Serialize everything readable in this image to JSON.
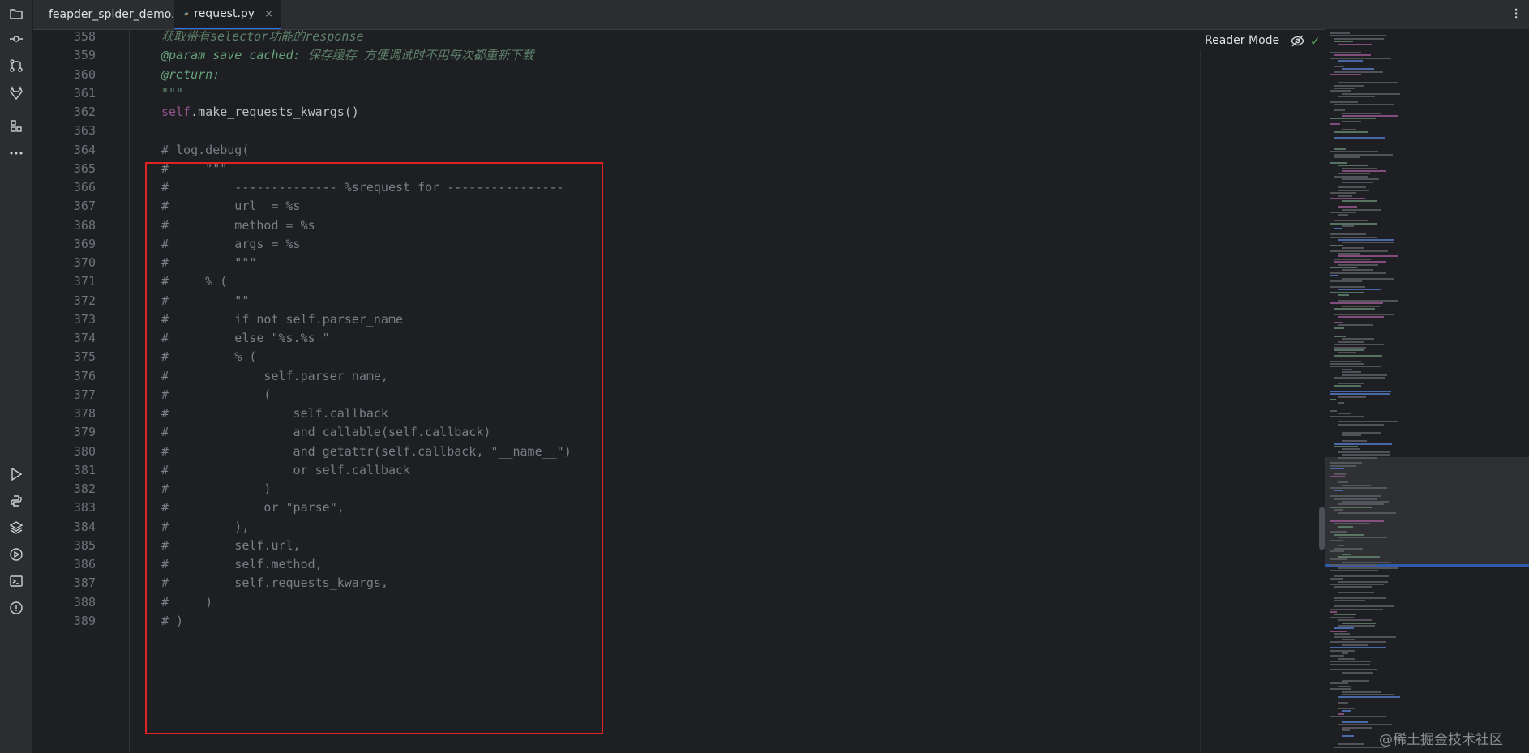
{
  "tabs": [
    {
      "label": "feapder_spider_demo.py",
      "active": false
    },
    {
      "label": "request.py",
      "active": true,
      "close": "×"
    }
  ],
  "reader_mode": "Reader Mode",
  "watermark": "@稀土掘金技术社区",
  "icons": {
    "toolstrip": [
      "project-icon",
      "commit-icon",
      "pull-requests-icon",
      "gitlab-icon",
      "structure-icon",
      "more-tools-icon",
      "run-icon",
      "python-console-icon",
      "layers-icon",
      "services-icon",
      "terminal-icon",
      "problems-icon"
    ],
    "reader": [
      "eye-slash-icon",
      "check-icon"
    ]
  },
  "colors": {
    "background": "#1e1f22",
    "highlight_box": "#e02424",
    "docstring": "#5f826b",
    "comment": "#7a7e85",
    "self": "#94558d",
    "accent": "#3574f0"
  },
  "lines": [
    {
      "n": "358",
      "parts": [
        {
          "t": "获取带有selector功能的response",
          "c": "doc"
        }
      ]
    },
    {
      "n": "359",
      "parts": [
        {
          "t": "@param save_cached:",
          "c": "doctag"
        },
        {
          "t": " 保存缓存 方便调试时不用每次都重新下载",
          "c": "doc"
        }
      ]
    },
    {
      "n": "360",
      "parts": [
        {
          "t": "@return:",
          "c": "doctag"
        }
      ]
    },
    {
      "n": "361",
      "parts": [
        {
          "t": "\"\"\"",
          "c": "doc"
        }
      ]
    },
    {
      "n": "362",
      "parts": [
        {
          "t": "self",
          "c": "kwself"
        },
        {
          "t": ".make_requests_kwargs()",
          "c": "plain"
        }
      ]
    },
    {
      "n": "363",
      "parts": []
    },
    {
      "n": "364",
      "parts": [
        {
          "t": "# log.debug(",
          "c": "cmt"
        }
      ]
    },
    {
      "n": "365",
      "parts": [
        {
          "t": "#     \"\"\"",
          "c": "cmt"
        }
      ]
    },
    {
      "n": "366",
      "parts": [
        {
          "t": "#         -------------- %srequest for ----------------",
          "c": "cmt"
        }
      ]
    },
    {
      "n": "367",
      "parts": [
        {
          "t": "#         url  = %s",
          "c": "cmt"
        }
      ]
    },
    {
      "n": "368",
      "parts": [
        {
          "t": "#         method = %s",
          "c": "cmt"
        }
      ]
    },
    {
      "n": "369",
      "parts": [
        {
          "t": "#         args = %s",
          "c": "cmt"
        }
      ]
    },
    {
      "n": "370",
      "parts": [
        {
          "t": "#         \"\"\"",
          "c": "cmt"
        }
      ]
    },
    {
      "n": "371",
      "parts": [
        {
          "t": "#     % (",
          "c": "cmt"
        }
      ]
    },
    {
      "n": "372",
      "parts": [
        {
          "t": "#         \"\"",
          "c": "cmt"
        }
      ]
    },
    {
      "n": "373",
      "parts": [
        {
          "t": "#         if not self.parser_name",
          "c": "cmt"
        }
      ]
    },
    {
      "n": "374",
      "parts": [
        {
          "t": "#         else \"%s.%s \"",
          "c": "cmt"
        }
      ]
    },
    {
      "n": "375",
      "parts": [
        {
          "t": "#         % (",
          "c": "cmt"
        }
      ]
    },
    {
      "n": "376",
      "parts": [
        {
          "t": "#             self.parser_name,",
          "c": "cmt"
        }
      ]
    },
    {
      "n": "377",
      "parts": [
        {
          "t": "#             (",
          "c": "cmt"
        }
      ]
    },
    {
      "n": "378",
      "parts": [
        {
          "t": "#                 self.callback",
          "c": "cmt"
        }
      ]
    },
    {
      "n": "379",
      "parts": [
        {
          "t": "#                 and callable(self.callback)",
          "c": "cmt"
        }
      ]
    },
    {
      "n": "380",
      "parts": [
        {
          "t": "#                 and getattr(self.callback, \"__name__\")",
          "c": "cmt"
        }
      ]
    },
    {
      "n": "381",
      "parts": [
        {
          "t": "#                 or self.callback",
          "c": "cmt"
        }
      ]
    },
    {
      "n": "382",
      "parts": [
        {
          "t": "#             )",
          "c": "cmt"
        }
      ]
    },
    {
      "n": "383",
      "parts": [
        {
          "t": "#             or \"parse\",",
          "c": "cmt"
        }
      ]
    },
    {
      "n": "384",
      "parts": [
        {
          "t": "#         ),",
          "c": "cmt"
        }
      ]
    },
    {
      "n": "385",
      "parts": [
        {
          "t": "#         self.url,",
          "c": "cmt"
        }
      ]
    },
    {
      "n": "386",
      "parts": [
        {
          "t": "#         self.method,",
          "c": "cmt"
        }
      ]
    },
    {
      "n": "387",
      "parts": [
        {
          "t": "#         self.requests_kwargs,",
          "c": "cmt"
        }
      ]
    },
    {
      "n": "388",
      "parts": [
        {
          "t": "#     )",
          "c": "cmt"
        }
      ]
    },
    {
      "n": "389",
      "parts": [
        {
          "t": "# )",
          "c": "cmt"
        }
      ]
    }
  ]
}
